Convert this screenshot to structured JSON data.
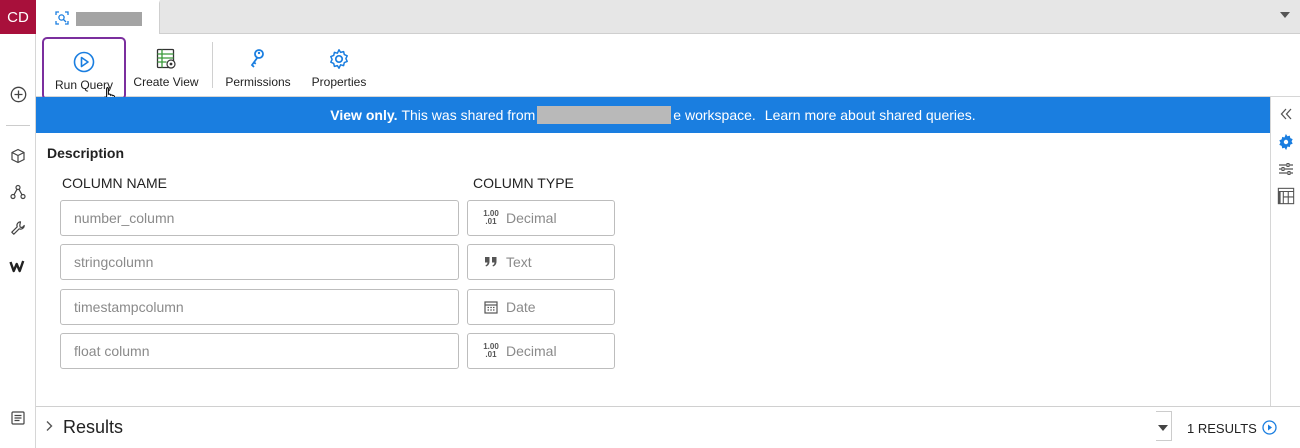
{
  "rail": {
    "avatar": "CD",
    "icons": [
      "add-circle-icon",
      "cube-icon",
      "graph-nodes-icon",
      "wrench-icon",
      "w-logo-icon",
      "document-list-icon"
    ]
  },
  "tab": {
    "icon": "query-tab-icon"
  },
  "toolbar": {
    "run_query": "Run Query",
    "create_view": "Create View",
    "permissions": "Permissions",
    "properties": "Properties"
  },
  "banner": {
    "bold": "View only.",
    "text_before": "This was shared from",
    "text_after": "e workspace.",
    "link": "Learn more about shared queries."
  },
  "main": {
    "description_label": "Description",
    "column_name_header": "COLUMN NAME",
    "column_type_header": "COLUMN TYPE",
    "columns": [
      {
        "name": "number_column",
        "type": "Decimal",
        "type_icon": "decimal-icon"
      },
      {
        "name": "stringcolumn",
        "type": "Text",
        "type_icon": "quote-icon"
      },
      {
        "name": "timestampcolumn",
        "type": "Date",
        "type_icon": "calendar-icon"
      },
      {
        "name": "float column",
        "type": "Decimal",
        "type_icon": "decimal-icon"
      }
    ],
    "decimal_icon_text": {
      "top": "1.00",
      "bottom": ".01"
    }
  },
  "results": {
    "label": "Results",
    "count": "1 RESULTS"
  },
  "colors": {
    "accent": "#1a7ee0",
    "avatar": "#a8103b",
    "highlight": "#7b2f9e"
  }
}
